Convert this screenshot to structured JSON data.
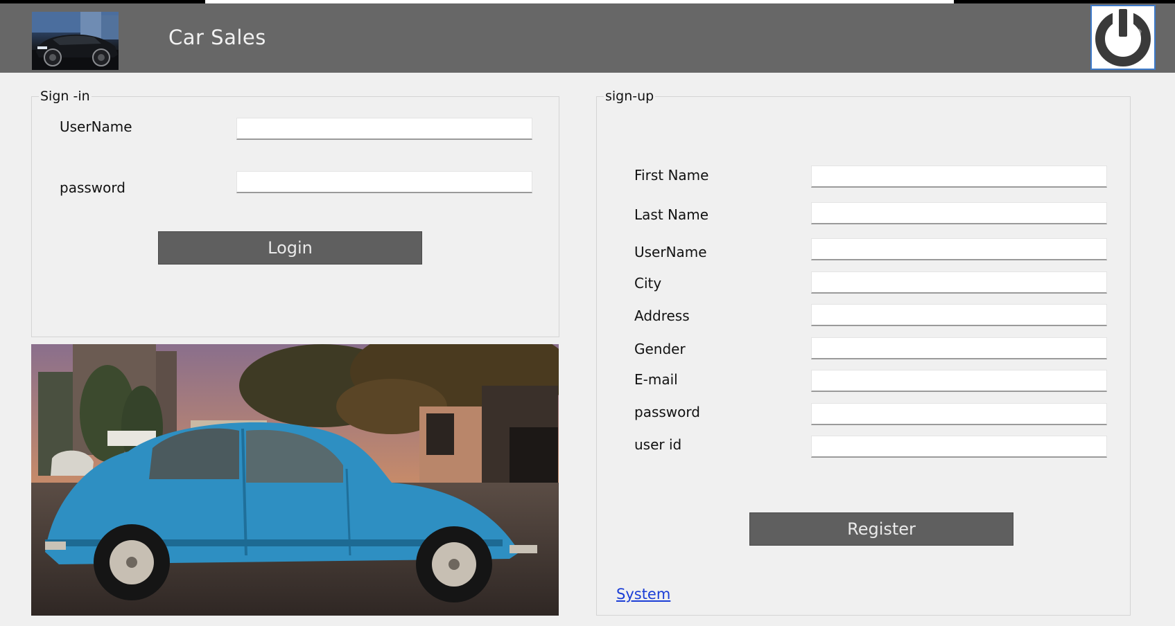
{
  "header": {
    "title": "Car Sales",
    "logo": "car-thumbnail",
    "power_icon": "power-icon"
  },
  "signin": {
    "legend": "Sign -in",
    "username_label": "UserName",
    "username_value": "",
    "password_label": "password",
    "password_value": "",
    "login_label": "Login"
  },
  "photo": "blue-vintage-beetle-car",
  "signup": {
    "legend": "sign-up",
    "fields": [
      {
        "label": "First Name",
        "value": ""
      },
      {
        "label": "Last Name",
        "value": ""
      },
      {
        "label": "UserName",
        "value": ""
      },
      {
        "label": "City",
        "value": ""
      },
      {
        "label": "Address",
        "value": ""
      },
      {
        "label": "Gender",
        "value": ""
      },
      {
        "label": "E-mail",
        "value": ""
      },
      {
        "label": "password",
        "value": ""
      },
      {
        "label": "user id",
        "value": ""
      }
    ],
    "register_label": "Register"
  },
  "footer": {
    "system_link": "System"
  },
  "colors": {
    "header_bg": "#676767",
    "button_bg": "#5f5f5f",
    "link": "#1a3dd6",
    "page_bg": "#f0f0f0"
  }
}
